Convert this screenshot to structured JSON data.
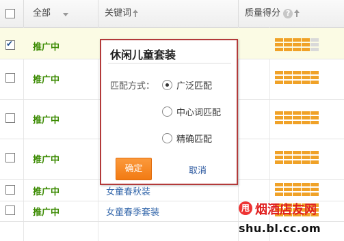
{
  "header": {
    "all_label": "全部",
    "keyword_label": "关键词",
    "quality_label": "质量得分",
    "help_glyph": "?"
  },
  "rows": [
    {
      "status": "推广中",
      "checked": true,
      "keyword": "",
      "quality": 4
    },
    {
      "status": "推广中",
      "checked": false,
      "keyword": "",
      "quality": 5
    },
    {
      "status": "推广中",
      "checked": false,
      "keyword": "",
      "quality": 5
    },
    {
      "status": "推广中",
      "checked": false,
      "keyword": "",
      "quality": 5
    },
    {
      "status": "推广中",
      "checked": false,
      "keyword": "女童春秋装",
      "quality": 5
    },
    {
      "status": "推广中",
      "checked": false,
      "keyword": "女童春季套装",
      "quality": 5
    }
  ],
  "dialog": {
    "title": "休闲儿童套装",
    "match_label": "匹配方式：",
    "options": [
      "广泛匹配",
      "中心词匹配",
      "精确匹配"
    ],
    "selected_index": 0,
    "ok_label": "确定",
    "cancel_label": "取消"
  },
  "watermark": {
    "logo_glyph": "甩",
    "text": "烟酒店友网",
    "url": "shu.bl.cc.om"
  },
  "colors": {
    "status_green": "#3a8a00",
    "keyword_blue": "#3366aa",
    "dialog_border": "#b33a3a",
    "ok_orange": "#f27b13",
    "quality_on": "#f0a228",
    "quality_off": "#d9d9d9"
  }
}
